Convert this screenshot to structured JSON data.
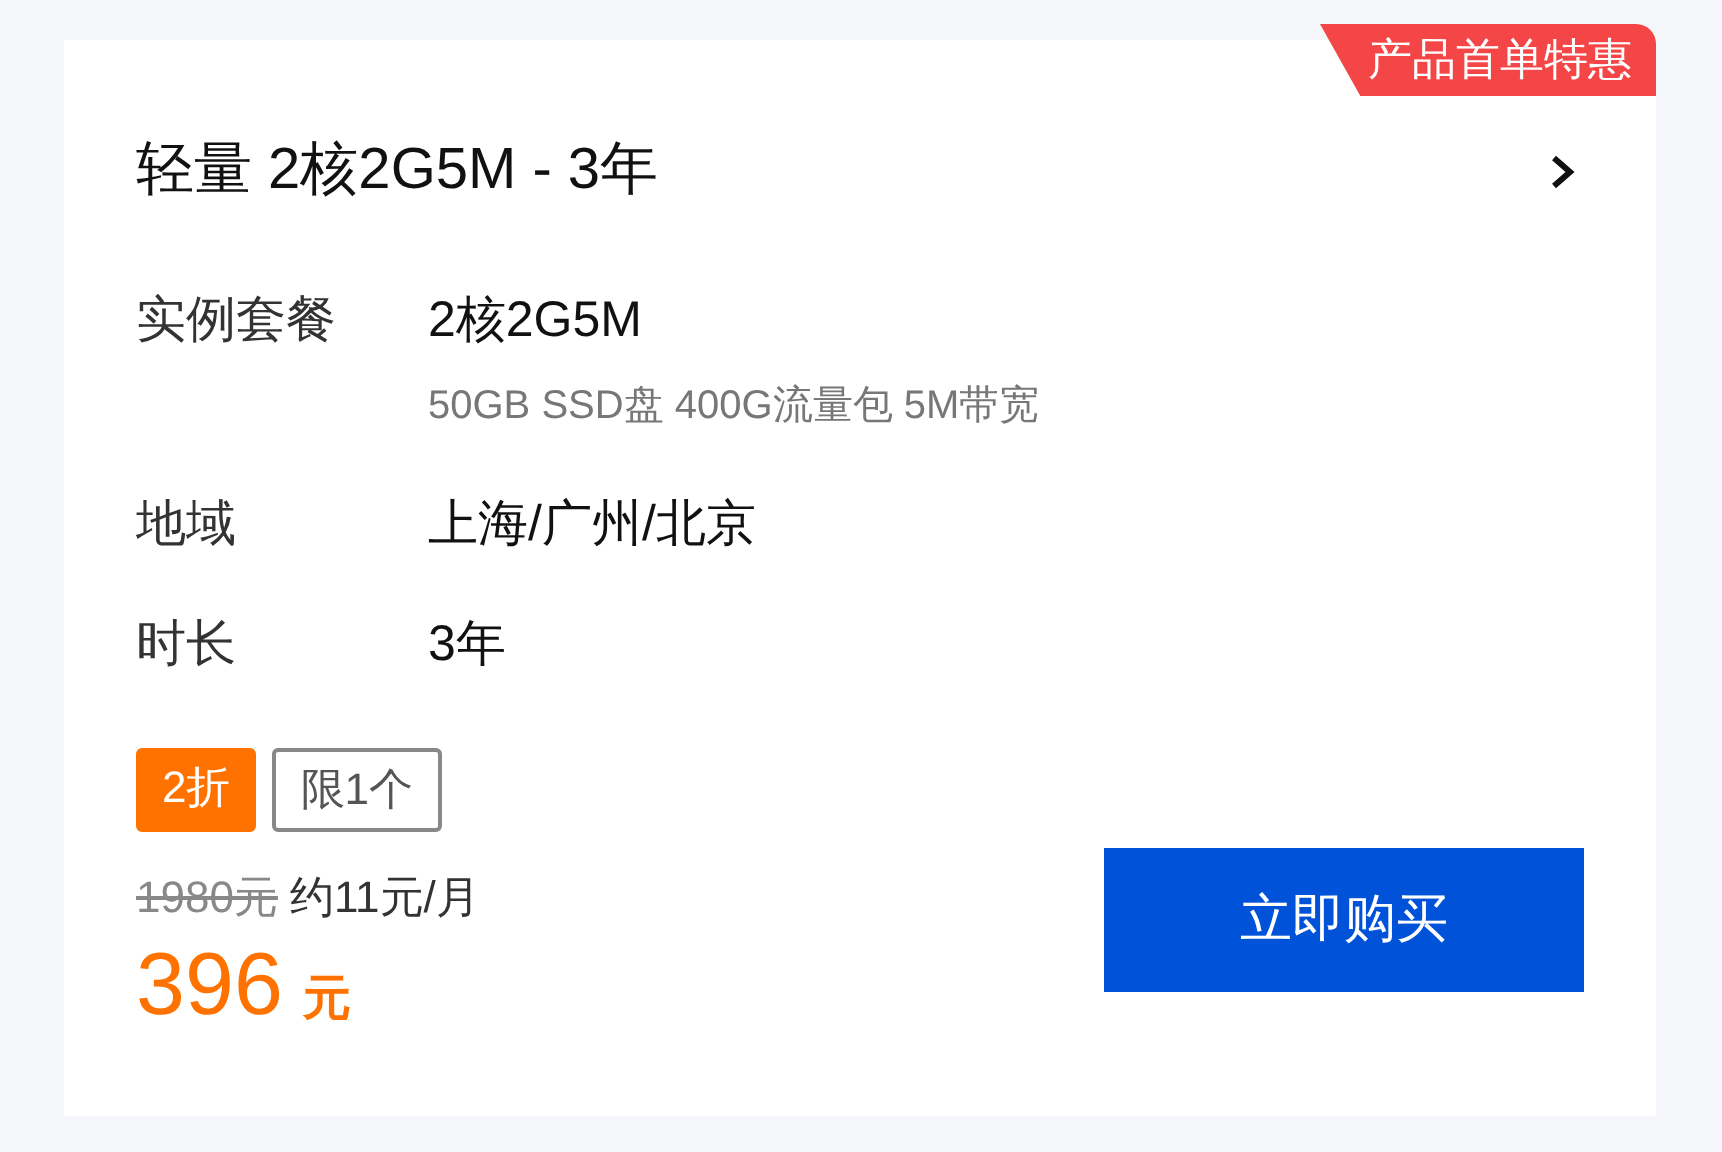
{
  "ribbon": "产品首单特惠",
  "title": "轻量 2核2G5M - 3年",
  "specs": [
    {
      "label": "实例套餐",
      "value": "2核2G5M",
      "detail": "50GB SSD盘 400G流量包 5M带宽"
    },
    {
      "label": "地域",
      "value": "上海/广州/北京"
    },
    {
      "label": "时长",
      "value": "3年"
    }
  ],
  "tags": [
    {
      "kind": "discount",
      "text": "2折"
    },
    {
      "kind": "limit",
      "text": "限1个"
    }
  ],
  "original_price": "1980元",
  "monthly": "约11元/月",
  "price": "396",
  "currency": "元",
  "buy_button": "立即购买"
}
